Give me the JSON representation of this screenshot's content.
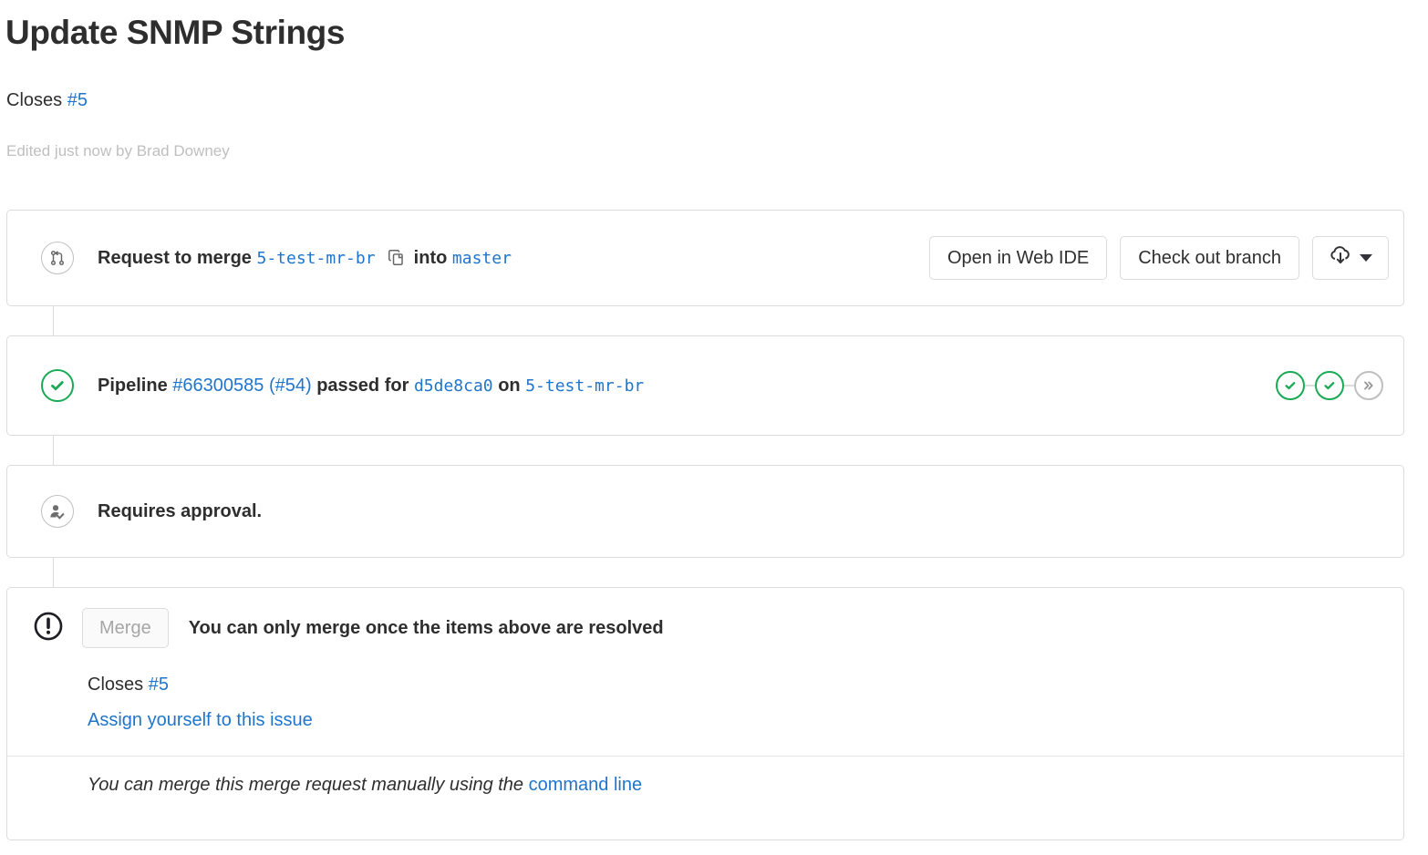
{
  "header": {
    "title": "Update SNMP Strings",
    "closes_prefix": "Closes",
    "closes_issue": "#5",
    "edited_note": "Edited just now by Brad Downey"
  },
  "merge_request_row": {
    "icon": "merge-request-icon",
    "label_prefix": "Request to merge",
    "source_branch": "5-test-mr-br",
    "copy_icon": "copy-icon",
    "into_label": "into",
    "target_branch": "master",
    "buttons": {
      "web_ide": "Open in Web IDE",
      "checkout": "Check out branch",
      "download_icon": "cloud-download-icon",
      "dropdown_icon": "chevron-down-icon"
    }
  },
  "pipeline_row": {
    "status_icon": "status-success-icon",
    "label": "Pipeline",
    "pipeline_id": "#66300585",
    "pipeline_iid": "(#54)",
    "state": "passed",
    "for_label": "for",
    "commit_sha": "d5de8ca0",
    "on_label": "on",
    "branch": "5-test-mr-br",
    "stages": [
      {
        "name": "stage-passed-1",
        "icon": "check-icon",
        "state": "success"
      },
      {
        "name": "stage-passed-2",
        "icon": "check-icon",
        "state": "success"
      },
      {
        "name": "stage-skipped",
        "icon": "double-chevron-icon",
        "state": "skipped"
      }
    ]
  },
  "approval_row": {
    "icon": "approval-required-icon",
    "text": "Requires approval."
  },
  "merge_section": {
    "warning_icon": "warning-icon",
    "merge_button": "Merge",
    "merge_message": "You can only merge once the items above are resolved",
    "closes_prefix": "Closes",
    "closes_issue": "#5",
    "assign_link": "Assign yourself to this issue",
    "footer_text": "You can merge this merge request manually using the",
    "footer_link": "command line"
  },
  "colors": {
    "link": "#1f75cb",
    "success": "#1aaa55",
    "border": "#dcdcdc",
    "muted": "#bfbfbf",
    "text": "#2e2e2e"
  }
}
